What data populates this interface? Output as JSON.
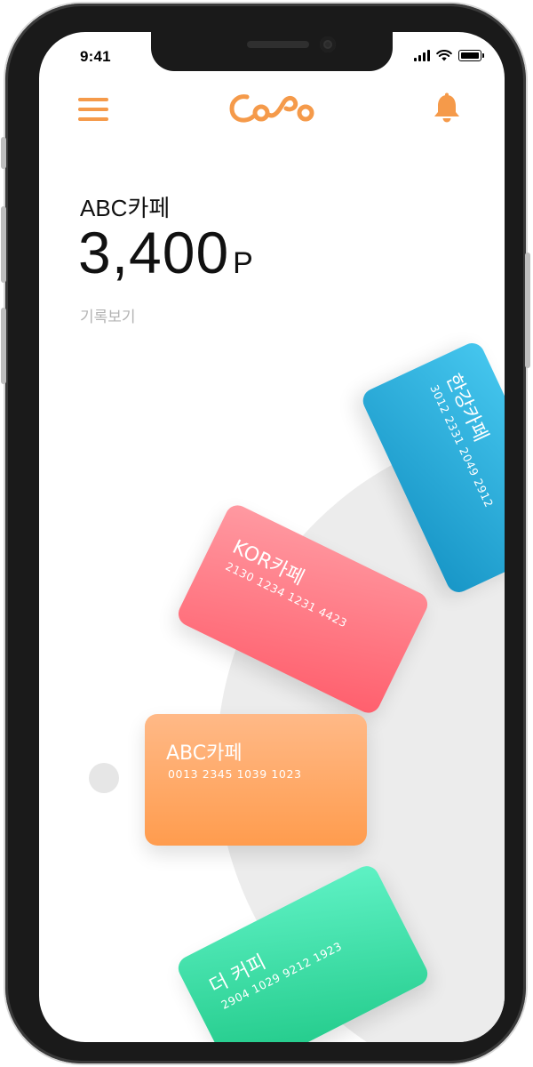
{
  "status_bar": {
    "time": "9:41"
  },
  "header": {
    "menu_icon": "hamburger-menu-icon",
    "logo_icon": "copo-logo",
    "bell_icon": "bell-icon"
  },
  "balance": {
    "store_name": "ABC카페",
    "points_value": "3,400",
    "points_unit": "P",
    "history_label": "기록보기"
  },
  "cards": [
    {
      "name": "한강카페",
      "number": "3012 2331 2049 2912",
      "color": "#1fa3d6"
    },
    {
      "name": "KOR카페",
      "number": "2130 1234 1231 4423",
      "color": "#ff6f7b"
    },
    {
      "name": "ABC카페",
      "number": "0013 2345 1039 1023",
      "color": "#ffa35c"
    },
    {
      "name": "더 커피",
      "number": "2904 1029 9212 1923",
      "color": "#2ed596"
    }
  ],
  "colors": {
    "accent": "#f59a4a",
    "background": "#ffffff",
    "wheel": "#ececec"
  }
}
